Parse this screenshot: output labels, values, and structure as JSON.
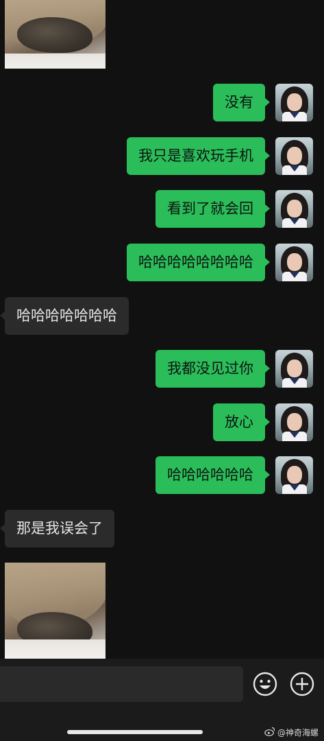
{
  "messages": [
    {
      "side": "out",
      "text": "没有"
    },
    {
      "side": "out",
      "text": "我只是喜欢玩手机"
    },
    {
      "side": "out",
      "text": "看到了就会回"
    },
    {
      "side": "out",
      "text": "哈哈哈哈哈哈哈哈"
    },
    {
      "side": "in",
      "text": "哈哈哈哈哈哈哈"
    },
    {
      "side": "out",
      "text": "我都没见过你"
    },
    {
      "side": "out",
      "text": "放心"
    },
    {
      "side": "out",
      "text": "哈哈哈哈哈哈"
    },
    {
      "side": "in",
      "text": "那是我误会了"
    }
  ],
  "input": {
    "value": "",
    "placeholder": ""
  },
  "icons": {
    "emoji": "emoji-icon",
    "add": "plus-icon",
    "weibo": "weibo-icon"
  },
  "watermark": {
    "text": "@神奇海螺"
  },
  "colors": {
    "outgoing_bubble": "#2bbd5a",
    "incoming_bubble": "#2b2b2b",
    "background": "#111111"
  }
}
